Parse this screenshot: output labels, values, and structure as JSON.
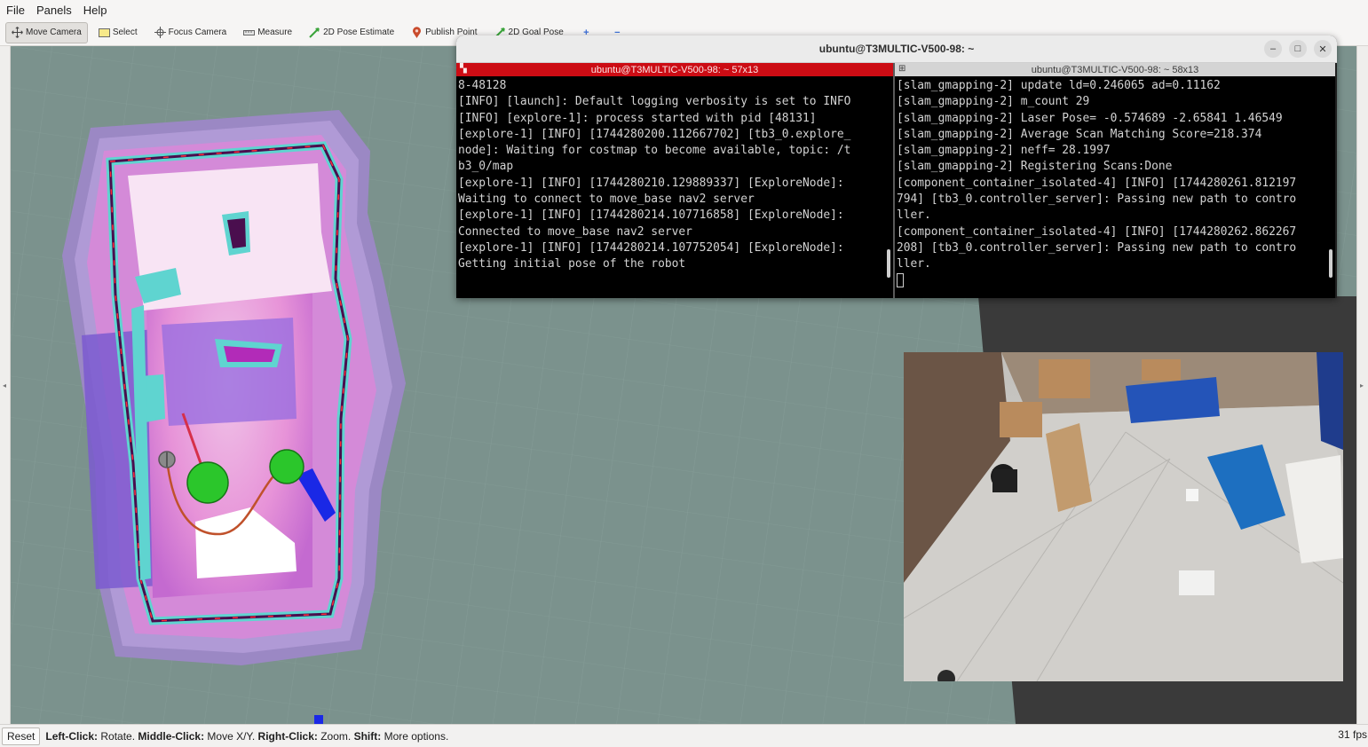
{
  "menu": {
    "items": [
      "File",
      "Panels",
      "Help"
    ]
  },
  "toolbar": {
    "move_camera": "Move Camera",
    "select": "Select",
    "focus_camera": "Focus Camera",
    "measure": "Measure",
    "pose_estimate": "2D Pose Estimate",
    "publish_point": "Publish Point",
    "goal_pose": "2D Goal Pose"
  },
  "terminal": {
    "title": "ubuntu@T3MULTIC-V500-98: ~",
    "left_pane_title": "ubuntu@T3MULTIC-V500-98: ~ 57x13",
    "right_pane_title": "ubuntu@T3MULTIC-V500-98: ~ 58x13",
    "left_lines": [
      "8-48128",
      "[INFO] [launch]: Default logging verbosity is set to INFO",
      "[INFO] [explore-1]: process started with pid [48131]",
      "[explore-1] [INFO] [1744280200.112667702] [tb3_0.explore_",
      "node]: Waiting for costmap to become available, topic: /t",
      "b3_0/map",
      "[explore-1] [INFO] [1744280210.129889337] [ExploreNode]:",
      "Waiting to connect to move_base nav2 server",
      "[explore-1] [INFO] [1744280214.107716858] [ExploreNode]:",
      "Connected to move_base nav2 server",
      "[explore-1] [INFO] [1744280214.107752054] [ExploreNode]:",
      "Getting initial pose of the robot"
    ],
    "right_lines": [
      "[slam_gmapping-2] update ld=0.246065 ad=0.11162",
      "[slam_gmapping-2] m_count 29",
      "[slam_gmapping-2] Laser Pose= -0.574689 -2.65841 1.46549",
      "[slam_gmapping-2] Average Scan Matching Score=218.374",
      "[slam_gmapping-2] neff= 28.1997",
      "[slam_gmapping-2] Registering Scans:Done",
      "[component_container_isolated-4] [INFO] [1744280261.812197",
      "794] [tb3_0.controller_server]: Passing new path to contro",
      "ller.",
      "[component_container_isolated-4] [INFO] [1744280262.862267",
      "208] [tb3_0.controller_server]: Passing new path to contro",
      "ller."
    ]
  },
  "status": {
    "reset_label": "Reset",
    "hint_left_key": "Left-Click:",
    "hint_left_val": " Rotate. ",
    "hint_middle_key": "Middle-Click:",
    "hint_middle_val": " Move X/Y. ",
    "hint_right_key": "Right-Click:",
    "hint_right_val": " Zoom. ",
    "hint_shift_key": "Shift:",
    "hint_shift_val": " More options.",
    "fps": "31 fps"
  },
  "icons": {
    "move_camera": "move-camera-icon",
    "select": "select-icon",
    "focus_camera": "focus-camera-icon",
    "measure": "measure-icon",
    "pose_estimate": "pose-estimate-icon",
    "publish_point": "publish-point-icon",
    "goal_pose": "goal-pose-icon",
    "add_tool": "add-tool-icon",
    "remove_tool": "remove-tool-icon"
  },
  "colors": {
    "grid_bg": "#7b928d",
    "terminal_left_tab": "#cc0c14",
    "goal_marker": "#2bc62b",
    "path": "#c0512b",
    "costmap_purple": "#7b5ad0",
    "wall_cyan": "#5fd4d0",
    "wall_dark": "#4a0e4e"
  }
}
